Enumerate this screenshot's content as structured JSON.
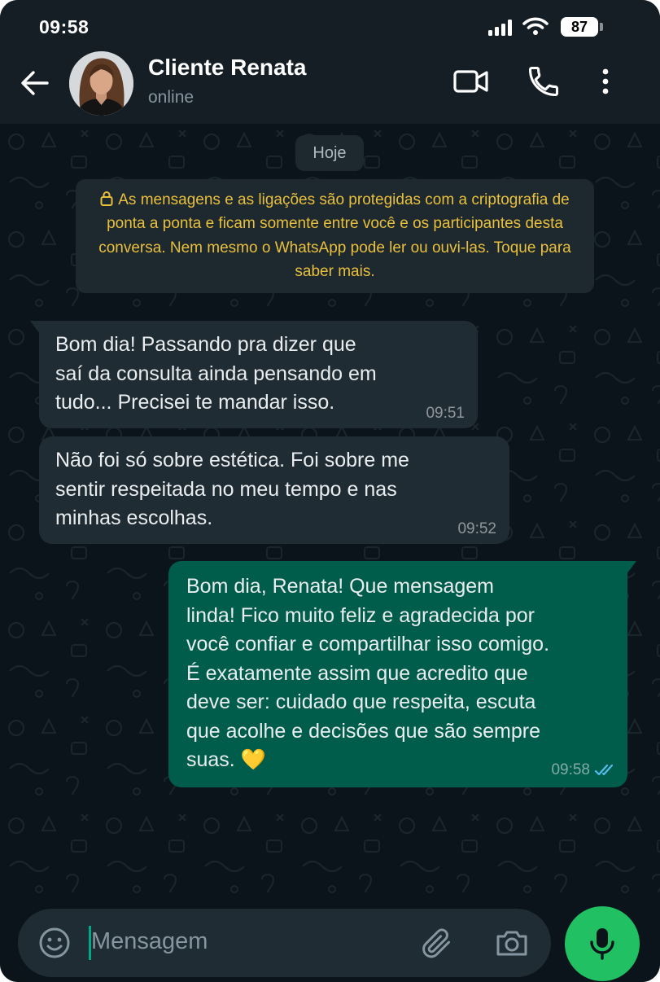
{
  "status_bar": {
    "time": "09:58",
    "battery": "87",
    "icons": [
      "cellular-signal-icon",
      "wifi-icon",
      "battery-icon"
    ]
  },
  "header": {
    "back_icon": "arrow-left-icon",
    "contact_name": "Cliente Renata",
    "contact_status": "online",
    "actions": [
      "video-camera-icon",
      "phone-icon",
      "more-vertical-icon"
    ]
  },
  "chat": {
    "date_label": "Hoje",
    "encryption_notice": "As mensagens e as ligações são protegidas com a criptografia de ponta a ponta e ficam somente entre você e os participantes desta conversa. Nem mesmo o WhatsApp pode ler ou ouvi-las. Toque para saber mais.",
    "messages": [
      {
        "direction": "incoming",
        "text": "Bom dia! Passando pra dizer que\nsaí da consulta ainda pensando em\ntudo... Precisei te mandar isso.",
        "time": "09:51"
      },
      {
        "direction": "incoming",
        "text": "Não foi só sobre estética. Foi sobre me\nsentir respeitada no meu tempo e nas\nminhas escolhas.",
        "time": "09:52"
      },
      {
        "direction": "outgoing",
        "text": "Bom dia, Renata! Que mensagem\nlinda! Fico muito feliz e agradecida por\nvocê confiar e compartilhar isso comigo.\nÉ exatamente assim que acredito que\ndeve ser: cuidado que respeita, escuta\nque acolhe e decisões que são sempre\nsuas. 💛",
        "time": "09:58",
        "status": "read"
      }
    ]
  },
  "input": {
    "placeholder": "Mensagem",
    "icons": [
      "emoji-icon",
      "paperclip-icon",
      "camera-icon",
      "microphone-icon"
    ]
  },
  "colors": {
    "background": "#0b141a",
    "header": "#151e24",
    "incoming_bubble": "#202c33",
    "outgoing_bubble": "#005c4b",
    "notice_text": "#e9c03c",
    "accent": "#21c063",
    "read_receipt": "#53bdeb"
  }
}
